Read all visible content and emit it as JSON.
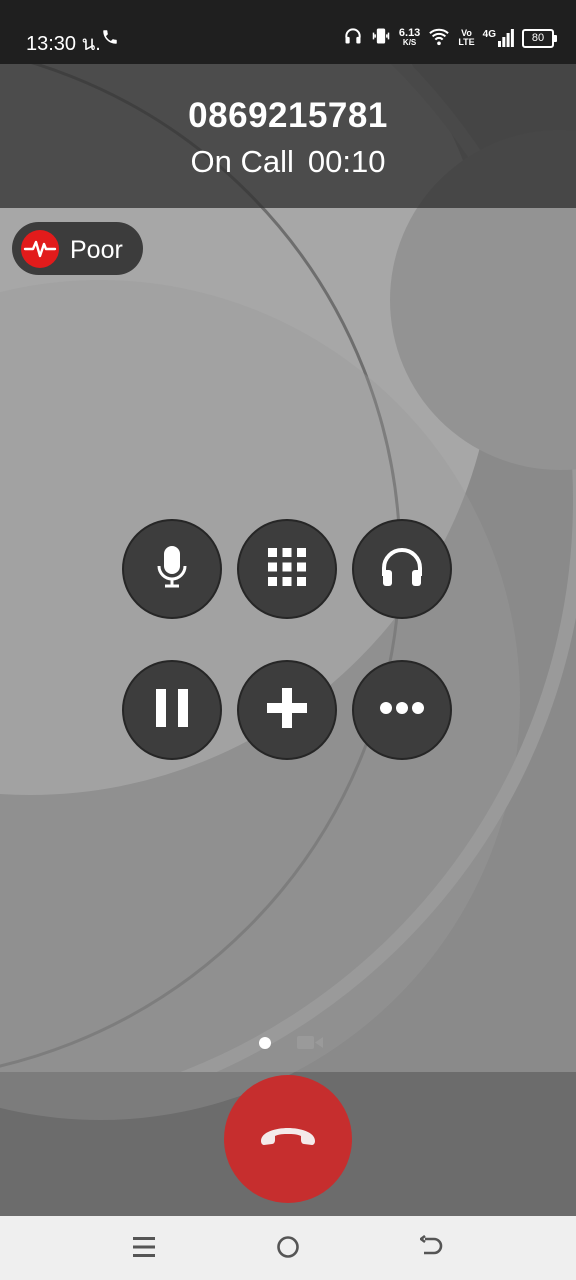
{
  "status_bar": {
    "time": "13:30 น.",
    "net_speed_value": "6.13",
    "net_speed_unit": "K/S",
    "volte_top": "Vo",
    "volte_bottom": "LTE",
    "network": "4G",
    "battery": "80"
  },
  "call": {
    "number": "0869215781",
    "state": "On Call",
    "duration": "00:10"
  },
  "quality": {
    "label": "Poor",
    "color": "#e21b1b"
  },
  "controls": [
    {
      "name": "mute",
      "icon": "microphone-icon"
    },
    {
      "name": "keypad",
      "icon": "keypad-icon"
    },
    {
      "name": "audio",
      "icon": "headphones-icon"
    },
    {
      "name": "hold",
      "icon": "pause-icon"
    },
    {
      "name": "add-call",
      "icon": "plus-icon"
    },
    {
      "name": "more",
      "icon": "more-dots-icon"
    }
  ],
  "end_call": {
    "color": "#c62e2e",
    "icon": "hang-up-icon"
  },
  "nav": [
    "menu-icon",
    "home-icon",
    "back-icon"
  ]
}
